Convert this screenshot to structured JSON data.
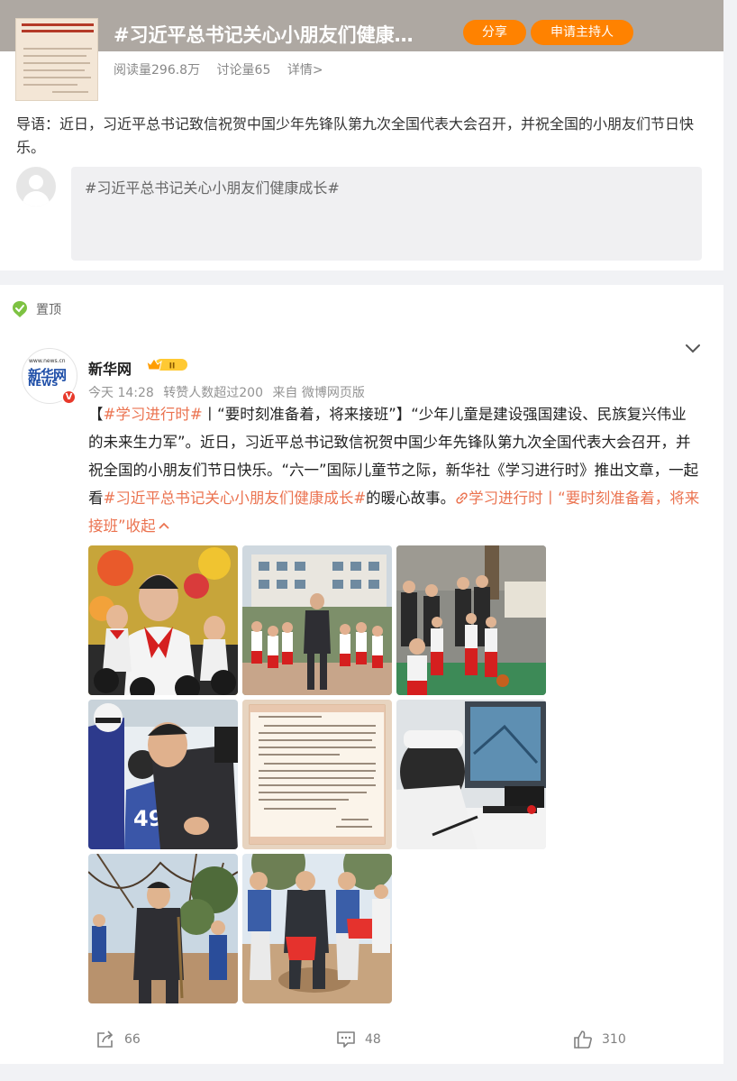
{
  "topic": {
    "title": "#习近平总书记关心小朋友们健康…",
    "share_label": "分享",
    "apply_host_label": "申请主持人",
    "read_count": "阅读量296.8万",
    "discuss_count": "讨论量65",
    "details_label": "详情>",
    "intro": "导语：近日，习近平总书记致信祝贺中国少年先锋队第九次全国代表大会召开，并祝全国的小朋友们节日快乐。",
    "composer_text": "#习近平总书记关心小朋友们健康成长#"
  },
  "post": {
    "pinned_label": "置顶",
    "author": "新华网",
    "avatar_text": {
      "url": "www.news.cn",
      "brand": "新华网",
      "brand2": "NEWS"
    },
    "time": "今天 14:28",
    "repost_note": "转赞人数超过200",
    "source": "来自 微博网页版",
    "body": {
      "bracket_open": "【",
      "tag1": "#学习进行时#",
      "part1": "丨“要时刻准备着，将来接班”】“少年儿童是建设强国建设、民族复兴伟业的未来生力军”。近日，习近平总书记致信祝贺中国少年先锋队第九次全国代表大会召开，并祝全国的小朋友们节日快乐。“六一”国际儿童节之际，新华社《学习进行时》推出文章，一起看",
      "tag2": "#习近平总书记关心小朋友们健康成长#",
      "part2": "的暖心故事。",
      "link_text": "学习进行时丨“要时刻准备着，将来接班”",
      "collapse_label": "收起"
    },
    "photos": [
      {
        "name": "photo-1"
      },
      {
        "name": "photo-2"
      },
      {
        "name": "photo-3"
      },
      {
        "name": "photo-4"
      },
      {
        "name": "photo-5"
      },
      {
        "name": "photo-6"
      },
      {
        "name": "photo-7"
      },
      {
        "name": "photo-8"
      }
    ],
    "actions": {
      "repost_count": "66",
      "comment_count": "48",
      "like_count": "310"
    }
  },
  "colors": {
    "accent_orange": "#ff8200",
    "hashtag": "#eb7350",
    "banner": "#aea8a2"
  }
}
